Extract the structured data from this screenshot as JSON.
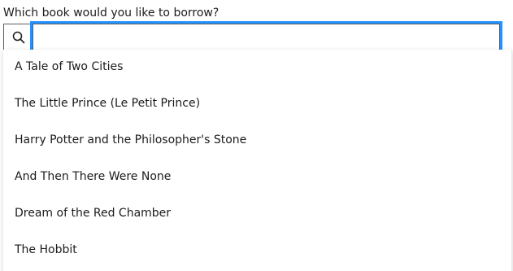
{
  "question": {
    "label": "Which book would you like to borrow?"
  },
  "search": {
    "icon": "search-icon",
    "value": "",
    "placeholder": ""
  },
  "listbox": {
    "options": [
      {
        "label": "A Tale of Two Cities"
      },
      {
        "label": "The Little Prince (Le Petit Prince)"
      },
      {
        "label": "Harry Potter and the Philosopher's Stone"
      },
      {
        "label": "And Then There Were None"
      },
      {
        "label": "Dream of the Red Chamber"
      },
      {
        "label": "The Hobbit"
      }
    ]
  },
  "colors": {
    "focus_outline": "#2491ff",
    "border": "#5c5c5c",
    "text": "#1b1b1b"
  }
}
